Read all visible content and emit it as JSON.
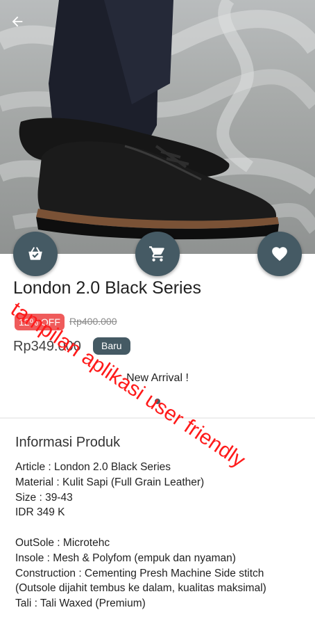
{
  "header": {
    "back_icon": "arrow-left-icon"
  },
  "actions": {
    "basket_icon": "basket-check-icon",
    "cart_icon": "shopping-cart-icon",
    "favorite_icon": "heart-icon",
    "button_color": "#455a64"
  },
  "product": {
    "title": "London 2.0 Black Series",
    "discount_label": "12% OFF",
    "old_price": "Rp400.000",
    "price": "Rp349.000",
    "condition_badge": "Baru",
    "tagline": "New Arrival !",
    "accent_discount": "#ef5b5b"
  },
  "info": {
    "heading": "Informasi Produk",
    "lines": [
      "Article : London 2.0 Black Series",
      "Material : Kulit Sapi (Full Grain Leather)",
      "Size : 39-43",
      "IDR 349 K",
      "",
      "OutSole : Microtehc",
      "Insole : Mesh & Polyfom (empuk dan nyaman)",
      "Construction : Cementing Presh Machine Side stitch (Outsole dijahit tembus ke dalam, kualitas maksimal)",
      "Tali : Tali Waxed (Premium)"
    ]
  },
  "watermark": {
    "text": "tampilan aplikasi user friendly",
    "color": "#ff1a1a"
  }
}
